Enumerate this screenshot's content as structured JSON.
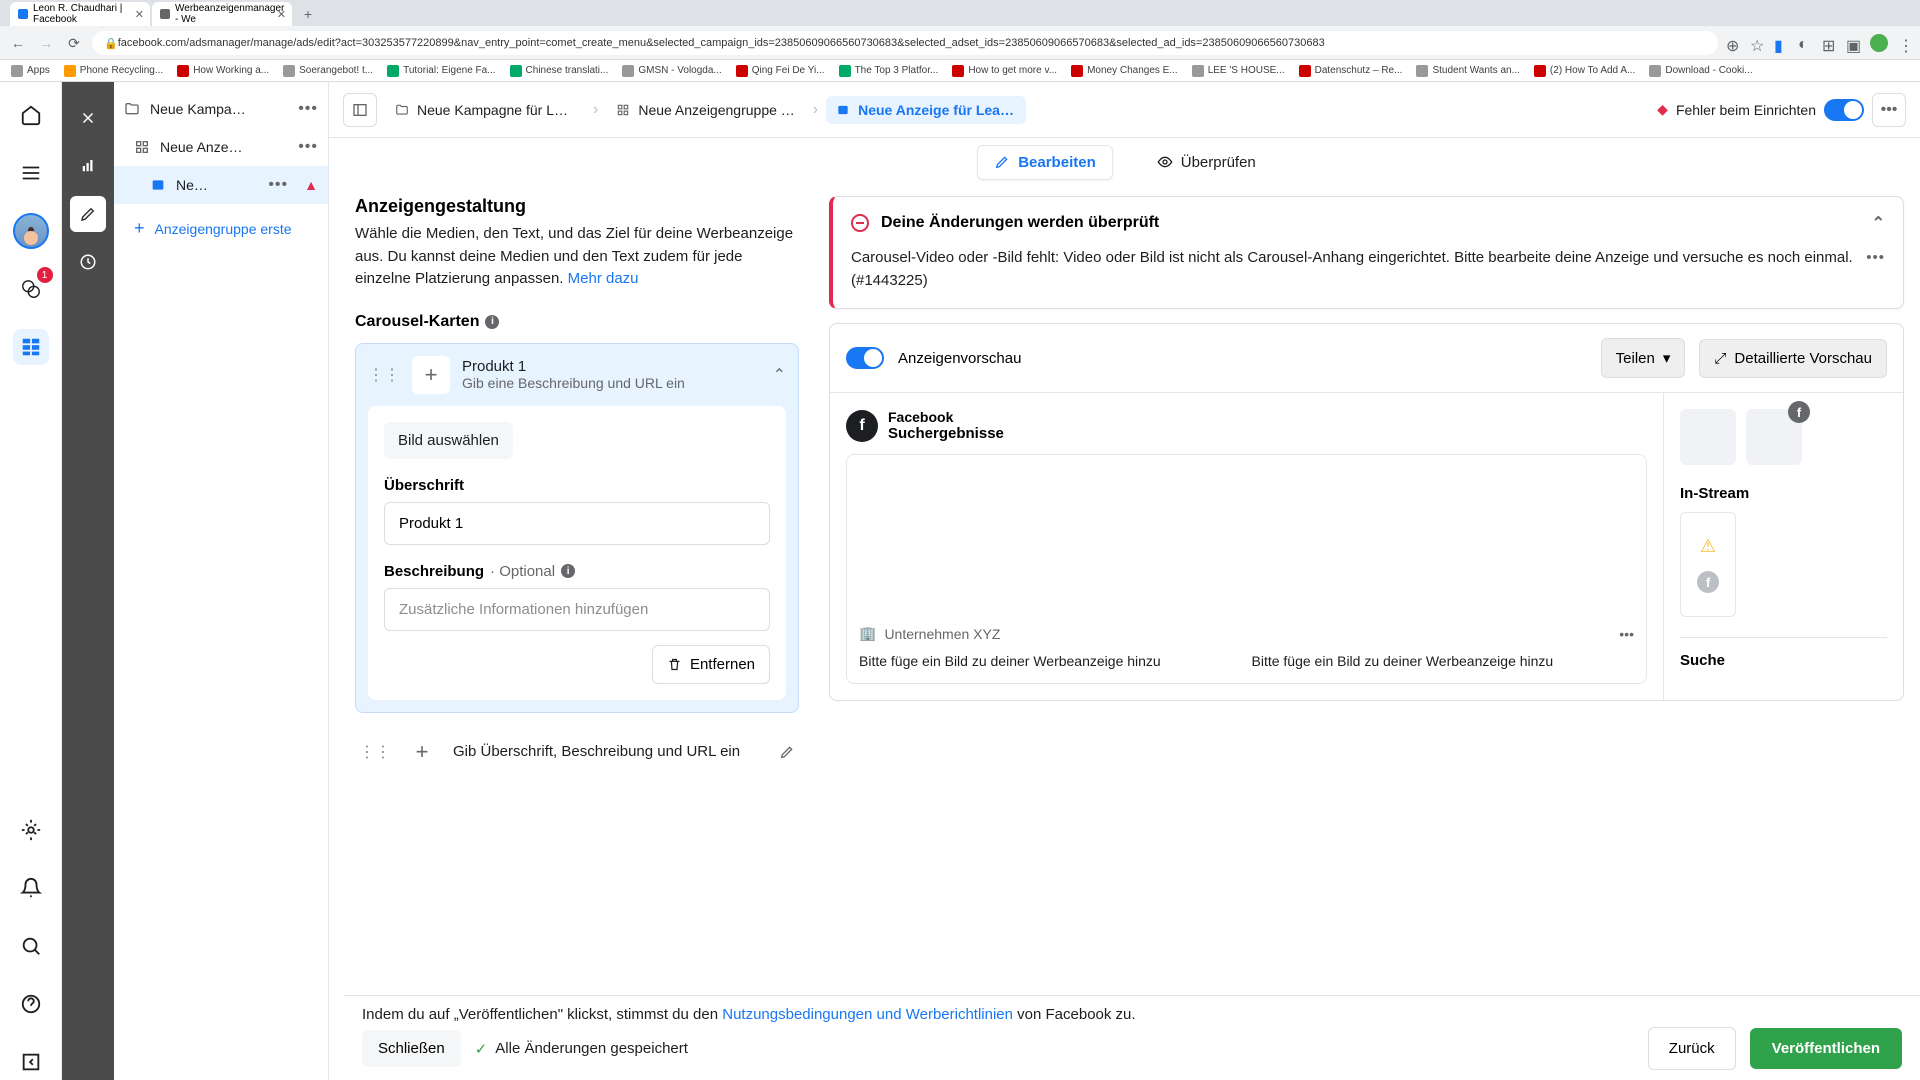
{
  "browser": {
    "tabs": [
      {
        "title": "Leon R. Chaudhari | Facebook"
      },
      {
        "title": "Werbeanzeigenmanager - We"
      }
    ],
    "url": "facebook.com/adsmanager/manage/ads/edit?act=303253577220899&nav_entry_point=comet_create_menu&selected_campaign_ids=23850609066560730683&selected_adset_ids=23850609066570683&selected_ad_ids=23850609066560730683",
    "bookmarks": [
      "Apps",
      "Phone Recycling...",
      "How Working a...",
      "Soerangebot! t...",
      "Tutorial: Eigene Fa...",
      "Chinese translati...",
      "GMSN - Vologda...",
      "Qing Fei De Yi...",
      "The Top 3 Platfor...",
      "How to get more v...",
      "Money Changes E...",
      "LEE 'S HOUSE...",
      "Datenschutz – Re...",
      "Student Wants an...",
      "(2) How To Add A...",
      "Download - Cooki..."
    ]
  },
  "rail": {
    "badge": "1"
  },
  "tree": {
    "campaign": "Neue Kampa…",
    "adset": "Neue Anze…",
    "ad": "Ne…",
    "add": "Anzeigengruppe erste"
  },
  "breadcrumb": {
    "campaign": "Neue Kampagne für Le…",
    "adset": "Neue Anzeigengruppe …",
    "ad": "Neue Anzeige für Lead…",
    "error": "Fehler beim Einrichten"
  },
  "tabs": {
    "edit": "Bearbeiten",
    "review": "Überprüfen"
  },
  "form": {
    "heading": "Anzeigengestaltung",
    "desc_pre": "Wähle die Medien, den Text, und das Ziel für deine Werbeanzeige aus. Du kannst deine Medien und den Text zudem für jede einzelne Platzierung anpassen. ",
    "desc_link": "Mehr dazu",
    "section": "Carousel-Karten",
    "card1": {
      "title": "Produkt 1",
      "sub": "Gib eine Beschreibung und URL ein",
      "select_image": "Bild auswählen",
      "headline_label": "Überschrift",
      "headline_value": "Produkt 1",
      "desc_label": "Beschreibung",
      "desc_optional": " · Optional",
      "desc_placeholder": "Zusätzliche Informationen hinzufügen",
      "remove": "Entfernen"
    },
    "card2_text": "Gib Überschrift, Beschreibung und URL ein"
  },
  "alert": {
    "title": "Deine Änderungen werden überprüft",
    "body": "Carousel-Video oder -Bild fehlt: Video oder Bild ist nicht als Carousel-Anhang eingerichtet. Bitte bearbeite deine Anzeige und versuche es noch einmal. (#1443225)"
  },
  "preview": {
    "title": "Anzeigenvorschau",
    "share": "Teilen",
    "detail": "Detaillierte Vorschau",
    "source_l1": "Facebook",
    "source_l2": "Suchergebnisse",
    "company": "Unternehmen XYZ",
    "msg": "Bitte füge ein Bild zu deiner Werbeanzeige hinzu",
    "instream": "In-Stream",
    "search": "Suche"
  },
  "footer": {
    "text_pre": "Indem du auf „Veröffentlichen\" klickst, stimmst du den ",
    "text_link": "Nutzungsbedingungen und Werberichtlinien",
    "text_post": " von Facebook zu.",
    "close": "Schließen",
    "saved": "Alle Änderungen gespeichert",
    "back": "Zurück",
    "publish": "Veröffentlichen"
  }
}
